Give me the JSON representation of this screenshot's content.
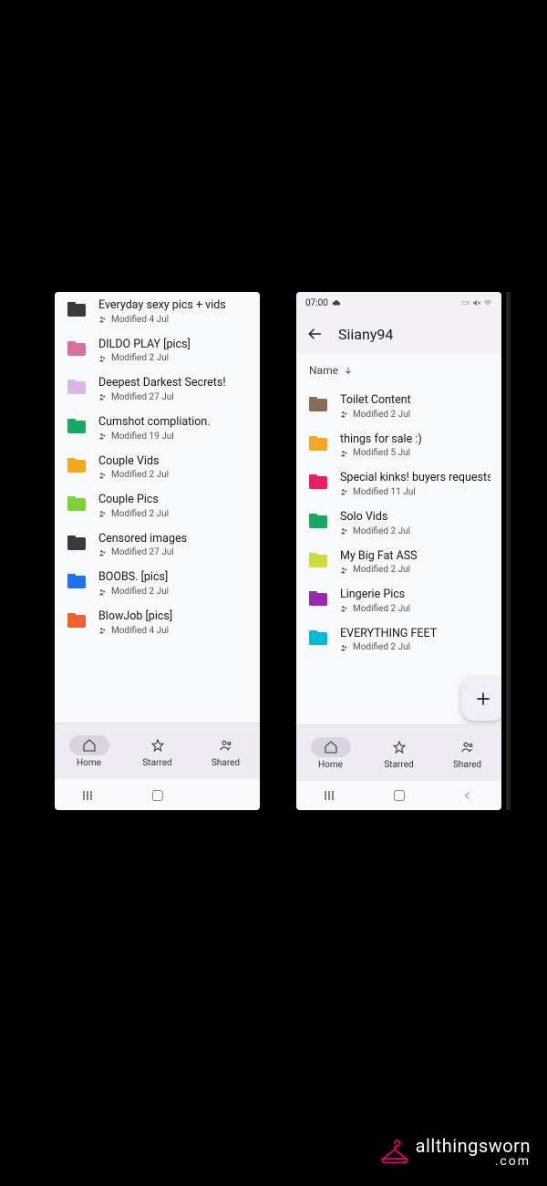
{
  "left": {
    "folders": [
      {
        "name": "Everyday sexy pics + vids",
        "modified": "Modified 4 Jul",
        "color": "#3a3a3a"
      },
      {
        "name": "DILDO PLAY [pics]",
        "modified": "Modified 2 Jul",
        "color": "#d76fa0"
      },
      {
        "name": "Deepest Darkest Secrets!",
        "modified": "Modified 27 Jul",
        "color": "#d9b7e6"
      },
      {
        "name": "Cumshot compliation.",
        "modified": "Modified 19 Jul",
        "color": "#18a862"
      },
      {
        "name": "Couple Vids",
        "modified": "Modified 2 Jul",
        "color": "#f5a623"
      },
      {
        "name": "Couple Pics",
        "modified": "Modified 2 Jul",
        "color": "#7fd13b"
      },
      {
        "name": "Censored images",
        "modified": "Modified 27 Jul",
        "color": "#3a3a3a"
      },
      {
        "name": "BOOBS. [pics]",
        "modified": "Modified 2 Jul",
        "color": "#1a73e8"
      },
      {
        "name": "BlowJob [pics]",
        "modified": "Modified 4 Jul",
        "color": "#f0622d"
      }
    ],
    "nav": {
      "home": "Home",
      "starred": "Starred",
      "shared": "Shared"
    }
  },
  "right": {
    "status_time": "07:00",
    "title": "Siiany94",
    "sort_label": "Name",
    "folders": [
      {
        "name": "Toilet Content",
        "modified": "Modified 2 Jul",
        "color": "#8a6b52"
      },
      {
        "name": "things for sale :)",
        "modified": "Modified 5 Jul",
        "color": "#f5a623"
      },
      {
        "name": "Special kinks! buyers requests",
        "modified": "Modified 11 Jul",
        "color": "#e91e63"
      },
      {
        "name": "Solo Vids",
        "modified": "Modified 2 Jul",
        "color": "#18a862"
      },
      {
        "name": "My Big Fat ASS",
        "modified": "Modified 2 Jul",
        "color": "#cddc39"
      },
      {
        "name": "Lingerie  Pics",
        "modified": "Modified 2 Jul",
        "color": "#9c27b0"
      },
      {
        "name": "EVERYTHING FEET",
        "modified": "Modified 2 Jul",
        "color": "#00bcd4"
      }
    ],
    "nav": {
      "home": "Home",
      "starred": "Starred",
      "shared": "Shared"
    }
  },
  "watermark": {
    "line1": "allthingsworn",
    "line2": ".com",
    "brand_color": "#e6007e"
  }
}
